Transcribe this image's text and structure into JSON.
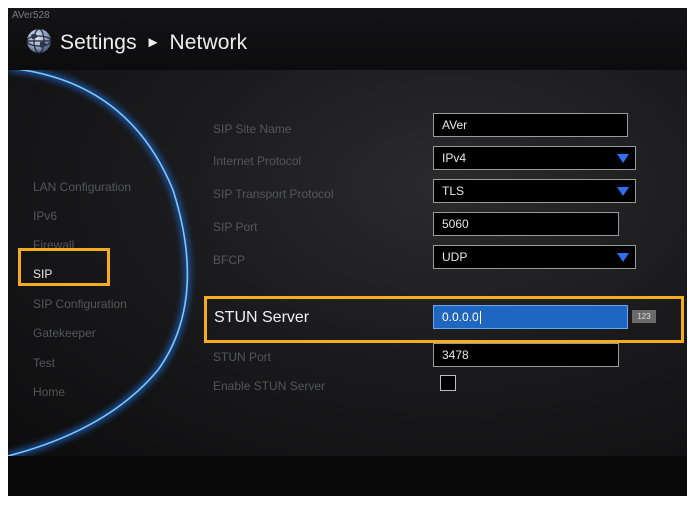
{
  "header": {
    "device_name": "AVer528",
    "title": "Settings",
    "arrow": "►",
    "page": "Network"
  },
  "sidebar": {
    "items": [
      {
        "label": "LAN Configuration",
        "active": false
      },
      {
        "label": "IPv6",
        "active": false
      },
      {
        "label": "Firewall",
        "active": false
      },
      {
        "label": "SIP",
        "active": true
      },
      {
        "label": "SIP Configuration",
        "active": false
      },
      {
        "label": "Gatekeeper",
        "active": false
      },
      {
        "label": "Test",
        "active": false
      },
      {
        "label": "Home",
        "active": false
      }
    ]
  },
  "form": {
    "sip_site_name": {
      "label": "SIP Site Name",
      "value": "AVer"
    },
    "internet_protocol": {
      "label": "Internet Protocol",
      "value": "IPv4"
    },
    "sip_transport_protocol": {
      "label": "SIP Transport Protocol",
      "value": "TLS"
    },
    "sip_port": {
      "label": "SIP Port",
      "value": "5060"
    },
    "bfcp": {
      "label": "BFCP",
      "value": "UDP"
    },
    "stun_server": {
      "label": "STUN Server",
      "value": "0.0.0.0",
      "input_mode": "123"
    },
    "stun_port": {
      "label": "STUN Port",
      "value": "3478"
    },
    "enable_stun_server": {
      "label": "Enable STUN Server",
      "checked": false
    }
  },
  "colors": {
    "highlight": "#f5ac1f",
    "focus_field": "#1f66c0",
    "dropdown_arrow": "#2f6ff0",
    "arc_glow": "#4aa8ff"
  }
}
